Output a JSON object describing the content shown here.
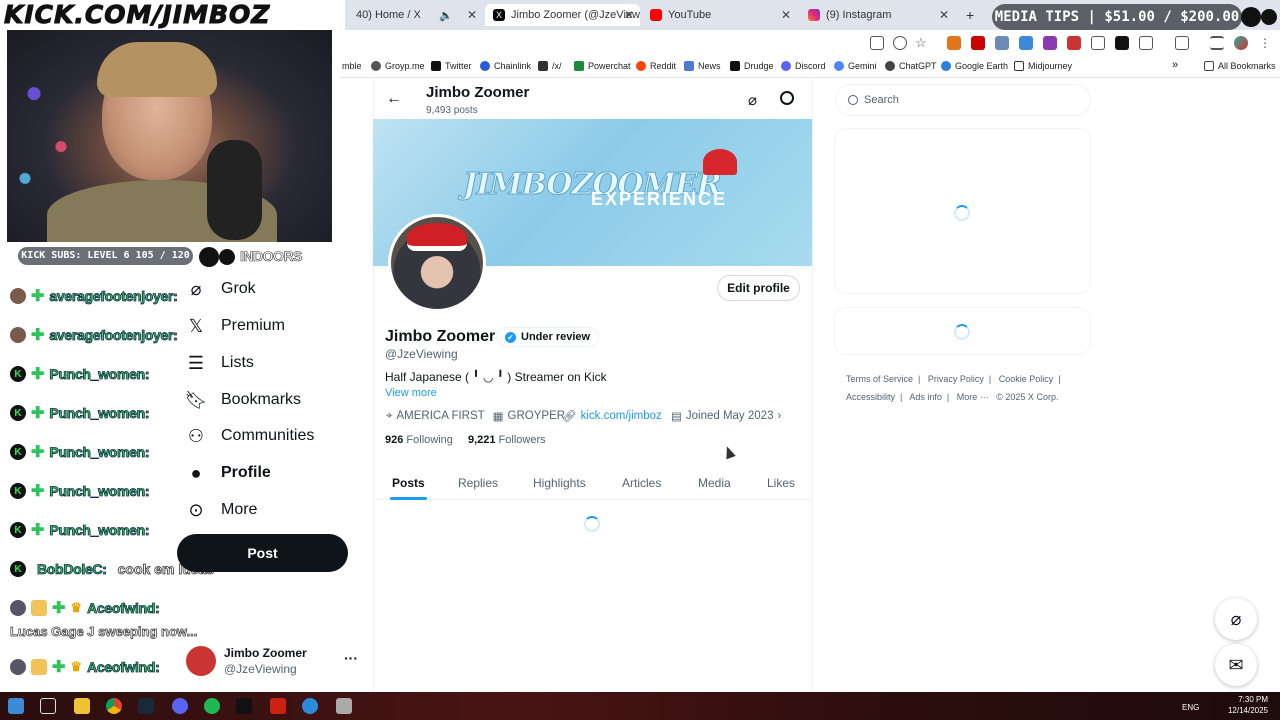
{
  "overlay": {
    "url_text": "KICK.COM/JIMBOZ",
    "subs_badge": "KICK SUBS: LEVEL 6 105 / 120",
    "indoors_text": "INDOORS",
    "media_tips": "MEDIA TIPS | $51.00 / $200.00"
  },
  "browser": {
    "tabs": [
      {
        "label": "40) Home / X",
        "active": false
      },
      {
        "label": "Jimbo Zoomer (@JzeViewing) /",
        "active": true
      },
      {
        "label": "YouTube",
        "active": false
      },
      {
        "label": "(9) Instagram",
        "active": false
      }
    ],
    "new_tab": "+",
    "bookmarks": [
      "mble",
      "Groyp.me",
      "Twitter",
      "Chainlink",
      "/x/",
      "Powerchat",
      "Reddit",
      "News",
      "Drudge",
      "Discord",
      "Gemini",
      "ChatGPT",
      "Google Earth",
      "Midjourney"
    ],
    "all_bookmarks": "All Bookmarks"
  },
  "chat": [
    {
      "name": "averagefootenjoyer:",
      "msg": "",
      "badge": "avatar"
    },
    {
      "name": "averagefootenjoyer:",
      "msg": "",
      "badge": "avatar"
    },
    {
      "name": "Punch_women:",
      "msg": "",
      "badge": "kick"
    },
    {
      "name": "Punch_women:",
      "msg": "",
      "badge": "kick"
    },
    {
      "name": "Punch_women:",
      "msg": "",
      "badge": "kick"
    },
    {
      "name": "Punch_women:",
      "msg": "",
      "badge": "kick"
    },
    {
      "name": "Punch_women:",
      "msg": "",
      "badge": "kick"
    },
    {
      "name": "BobDoleC:",
      "msg": "cook em lucas",
      "badge": "kick"
    },
    {
      "name": "Aceofwind:",
      "msg": "",
      "badge": "crown"
    },
    {
      "name": "Aceofwind:",
      "msg": "",
      "badge": "crown"
    }
  ],
  "chat_plain": "Lucas Gage J sweeping now...",
  "nav": {
    "items": [
      "Grok",
      "Premium",
      "Lists",
      "Bookmarks",
      "Communities",
      "Profile",
      "More"
    ],
    "post_button": "Post",
    "account_name": "Jimbo Zoomer",
    "account_handle": "@JzeViewing",
    "account_more": "···"
  },
  "profile": {
    "header_name": "Jimbo Zoomer",
    "header_posts": "9,493 posts",
    "banner_text": "JIMBOZOOMER",
    "banner_sub": "EXPERIENCE",
    "edit_button": "Edit profile",
    "display_name": "Jimbo Zoomer",
    "badge": "Under review",
    "handle": "@JzeViewing",
    "bio": "Half Japanese ( ╹ ◡ ╹ ) Streamer on Kick",
    "view_more": "View more",
    "location": "AMERICA FIRST",
    "location2": "GROYPER",
    "link": "kick.com/jimboz",
    "joined": "Joined May 2023",
    "following_count": "926",
    "following_label": "Following",
    "followers_count": "9,221",
    "followers_label": "Followers",
    "tabs": [
      "Posts",
      "Replies",
      "Highlights",
      "Articles",
      "Media",
      "Likes"
    ]
  },
  "sidebar": {
    "search_placeholder": "Search",
    "footer": [
      "Terms of Service",
      "Privacy Policy",
      "Cookie Policy",
      "Accessibility",
      "Ads info",
      "More ···",
      "© 2025 X Corp."
    ]
  },
  "taskbar": {
    "lang": "ENG",
    "time": "7:30 PM",
    "date": "12/14/2025"
  },
  "colors": {
    "accent": "#1d9bf0",
    "kick_green": "#2fd05a"
  }
}
